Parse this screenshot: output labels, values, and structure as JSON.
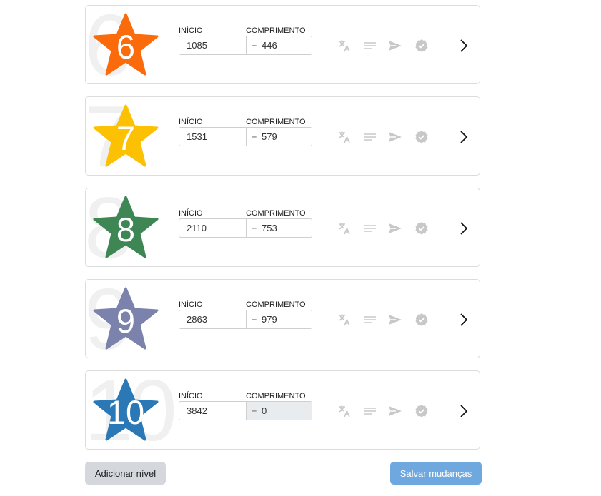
{
  "labels": {
    "start": "INÍCIO",
    "length": "COMPRIMENTO",
    "plus": "+"
  },
  "levels": [
    {
      "number": "6",
      "star_color": "#fb6b0b",
      "start": "1085",
      "length": "446",
      "length_disabled": false
    },
    {
      "number": "7",
      "star_color": "#fdc103",
      "start": "1531",
      "length": "579",
      "length_disabled": false
    },
    {
      "number": "8",
      "star_color": "#3e8654",
      "start": "2110",
      "length": "753",
      "length_disabled": false
    },
    {
      "number": "9",
      "star_color": "#7b83ad",
      "start": "2863",
      "length": "979",
      "length_disabled": false
    },
    {
      "number": "10",
      "star_color": "#2b78b6",
      "start": "3842",
      "length": "0",
      "length_disabled": true
    }
  ],
  "icons": {
    "translate": "translate-icon",
    "lines": "lines-icon",
    "send": "send-icon",
    "verified": "verified-check-icon",
    "chevron": "chevron-right-icon"
  },
  "actions": {
    "add_level": "Adicionar nível",
    "save_changes": "Salvar mudanças"
  },
  "colors": {
    "icon_muted": "#c8c8c8",
    "save_button": "#6fa8de",
    "add_button": "#d4d8dd"
  }
}
